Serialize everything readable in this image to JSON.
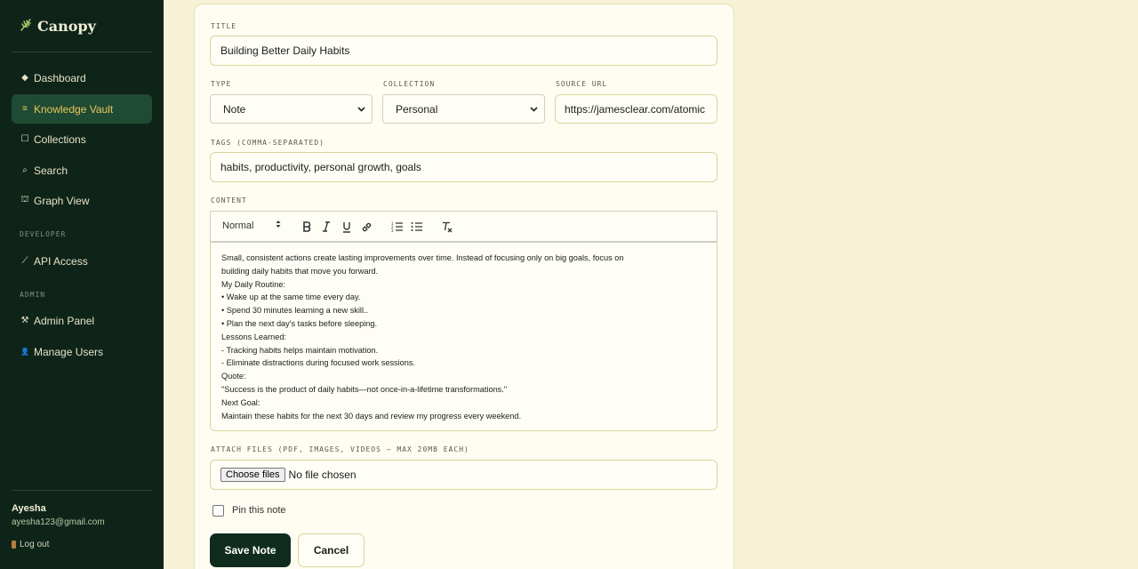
{
  "app": {
    "name": "Canopy",
    "logo_icon": "leaf-icon"
  },
  "sidebar": {
    "items": [
      {
        "label": "Dashboard",
        "icon": "diamond-icon",
        "glyph": "◆"
      },
      {
        "label": "Knowledge Vault",
        "icon": "vault-icon",
        "glyph": "≡",
        "active": true
      },
      {
        "label": "Collections",
        "icon": "square-icon",
        "glyph": "☐"
      },
      {
        "label": "Search",
        "icon": "search-icon",
        "glyph": "⌕"
      },
      {
        "label": "Graph View",
        "icon": "graph-icon",
        "glyph": "⛫"
      }
    ],
    "developer_label": "DEVELOPER",
    "developer_items": [
      {
        "label": "API Access",
        "icon": "wand-icon",
        "glyph": "⟋"
      }
    ],
    "admin_label": "ADMIN",
    "admin_items": [
      {
        "label": "Admin Panel",
        "icon": "tools-icon",
        "glyph": "⚒"
      },
      {
        "label": "Manage Users",
        "icon": "user-icon",
        "glyph": "👤"
      }
    ]
  },
  "user": {
    "name": "Ayesha",
    "email": "ayesha123@gmail.com",
    "logout_label": "Log out"
  },
  "form": {
    "title_label": "TITLE",
    "title_value": "Building Better Daily Habits",
    "type_label": "TYPE",
    "type_value": "Note",
    "collection_label": "COLLECTION",
    "collection_value": "Personal",
    "source_label": "SOURCE URL",
    "source_value": "https://jamesclear.com/atomic",
    "tags_label": "TAGS (COMMA-SEPARATED)",
    "tags_value": "habits, productivity, personal growth, goals",
    "content_label": "CONTENT",
    "toolbar": {
      "format_value": "Normal"
    },
    "content_lines": [
      "Small, consistent actions create lasting improvements over time. Instead of focusing only on big goals, focus on",
      "building daily habits that move you forward.",
      "My Daily Routine:",
      "• Wake up at the same time every day.",
      "• Spend 30 minutes learning a new skill..",
      "• Plan the next day's tasks before sleeping.",
      "Lessons Learned:",
      "- Tracking habits helps maintain motivation.",
      "- Eliminate distractions during focused work sessions.",
      "Quote:",
      "\"Success is the product of daily habits—not once-in-a-lifetime transformations.\"",
      "Next Goal:",
      "Maintain these habits for the next 30 days and review my progress every weekend."
    ],
    "attach_label": "ATTACH FILES (PDF, IMAGES, VIDEOS — MAX 20MB EACH)",
    "choose_files_label": "Choose files",
    "file_status": "No file chosen",
    "pin_label": "Pin this note",
    "pin_checked": false,
    "save_label": "Save Note",
    "cancel_label": "Cancel"
  },
  "colors": {
    "sidebar_bg": "#0f2419",
    "active_bg": "#1f4a33",
    "active_text": "#e8c65c",
    "page_bg": "#f7f2d6",
    "primary_button": "#0f2c1e"
  }
}
